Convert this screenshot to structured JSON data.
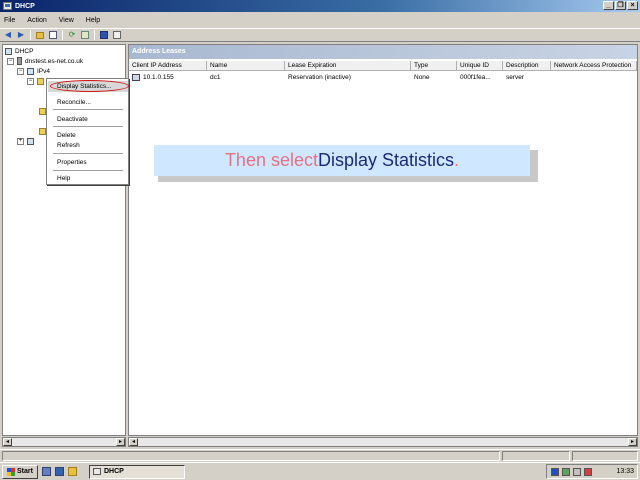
{
  "window": {
    "title": "DHCP",
    "minimize": "_",
    "maximize": "❐",
    "close": "×"
  },
  "menu": [
    "File",
    "Action",
    "View",
    "Help"
  ],
  "tree": {
    "root": "DHCP",
    "server": "dnstest.es-net.co.uk",
    "ipv4": "IPv4",
    "scope_expander": "+",
    "ipv6_expander": "+"
  },
  "context_menu": {
    "items": [
      "Display Statistics...",
      "Reconcile...",
      "Deactivate",
      "Delete",
      "Refresh",
      "Properties",
      "Help"
    ]
  },
  "right_pane": {
    "title": "Address Leases",
    "columns": [
      "Client IP Address",
      "Name",
      "Lease Expiration",
      "Type",
      "Unique ID",
      "Description",
      "Network Access Protection"
    ],
    "rows": [
      [
        "10.1.0.155",
        "dc1",
        "Reservation (inactive)",
        "None",
        "000f1fea...",
        "server",
        ""
      ]
    ]
  },
  "callout": {
    "part1": "Then select ",
    "part2": "Display Statistics",
    "part3": "."
  },
  "taskbar": {
    "start": "Start",
    "task": "DHCP",
    "clock": "13:33"
  },
  "scroll": {
    "left": "◂",
    "right": "▸"
  }
}
